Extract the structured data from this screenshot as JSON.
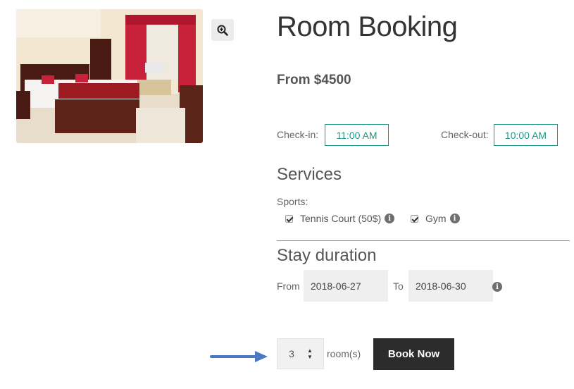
{
  "product": {
    "title": "Room Booking",
    "price": "From $4500",
    "image_alt": "hotel room bed",
    "zoom_icon": "magnifier-plus-icon"
  },
  "times": {
    "checkin_label": "Check-in:",
    "checkin_value": "11:00 AM",
    "checkout_label": "Check-out:",
    "checkout_value": "10:00 AM"
  },
  "services": {
    "heading": "Services",
    "group_label": "Sports:",
    "items": [
      {
        "label": "Tennis Court (50$)",
        "checked": true
      },
      {
        "label": "Gym",
        "checked": true
      }
    ]
  },
  "stay": {
    "heading": "Stay duration",
    "from_label": "From",
    "from_value": "2018-06-27",
    "to_label": "To",
    "to_value": "2018-06-30"
  },
  "booking": {
    "quantity": "3",
    "quantity_unit": "room(s)",
    "button_label": "Book Now"
  },
  "colors": {
    "accent": "#1a9a86",
    "button_bg": "#2c2c2c",
    "arrow": "#4a78c2"
  }
}
